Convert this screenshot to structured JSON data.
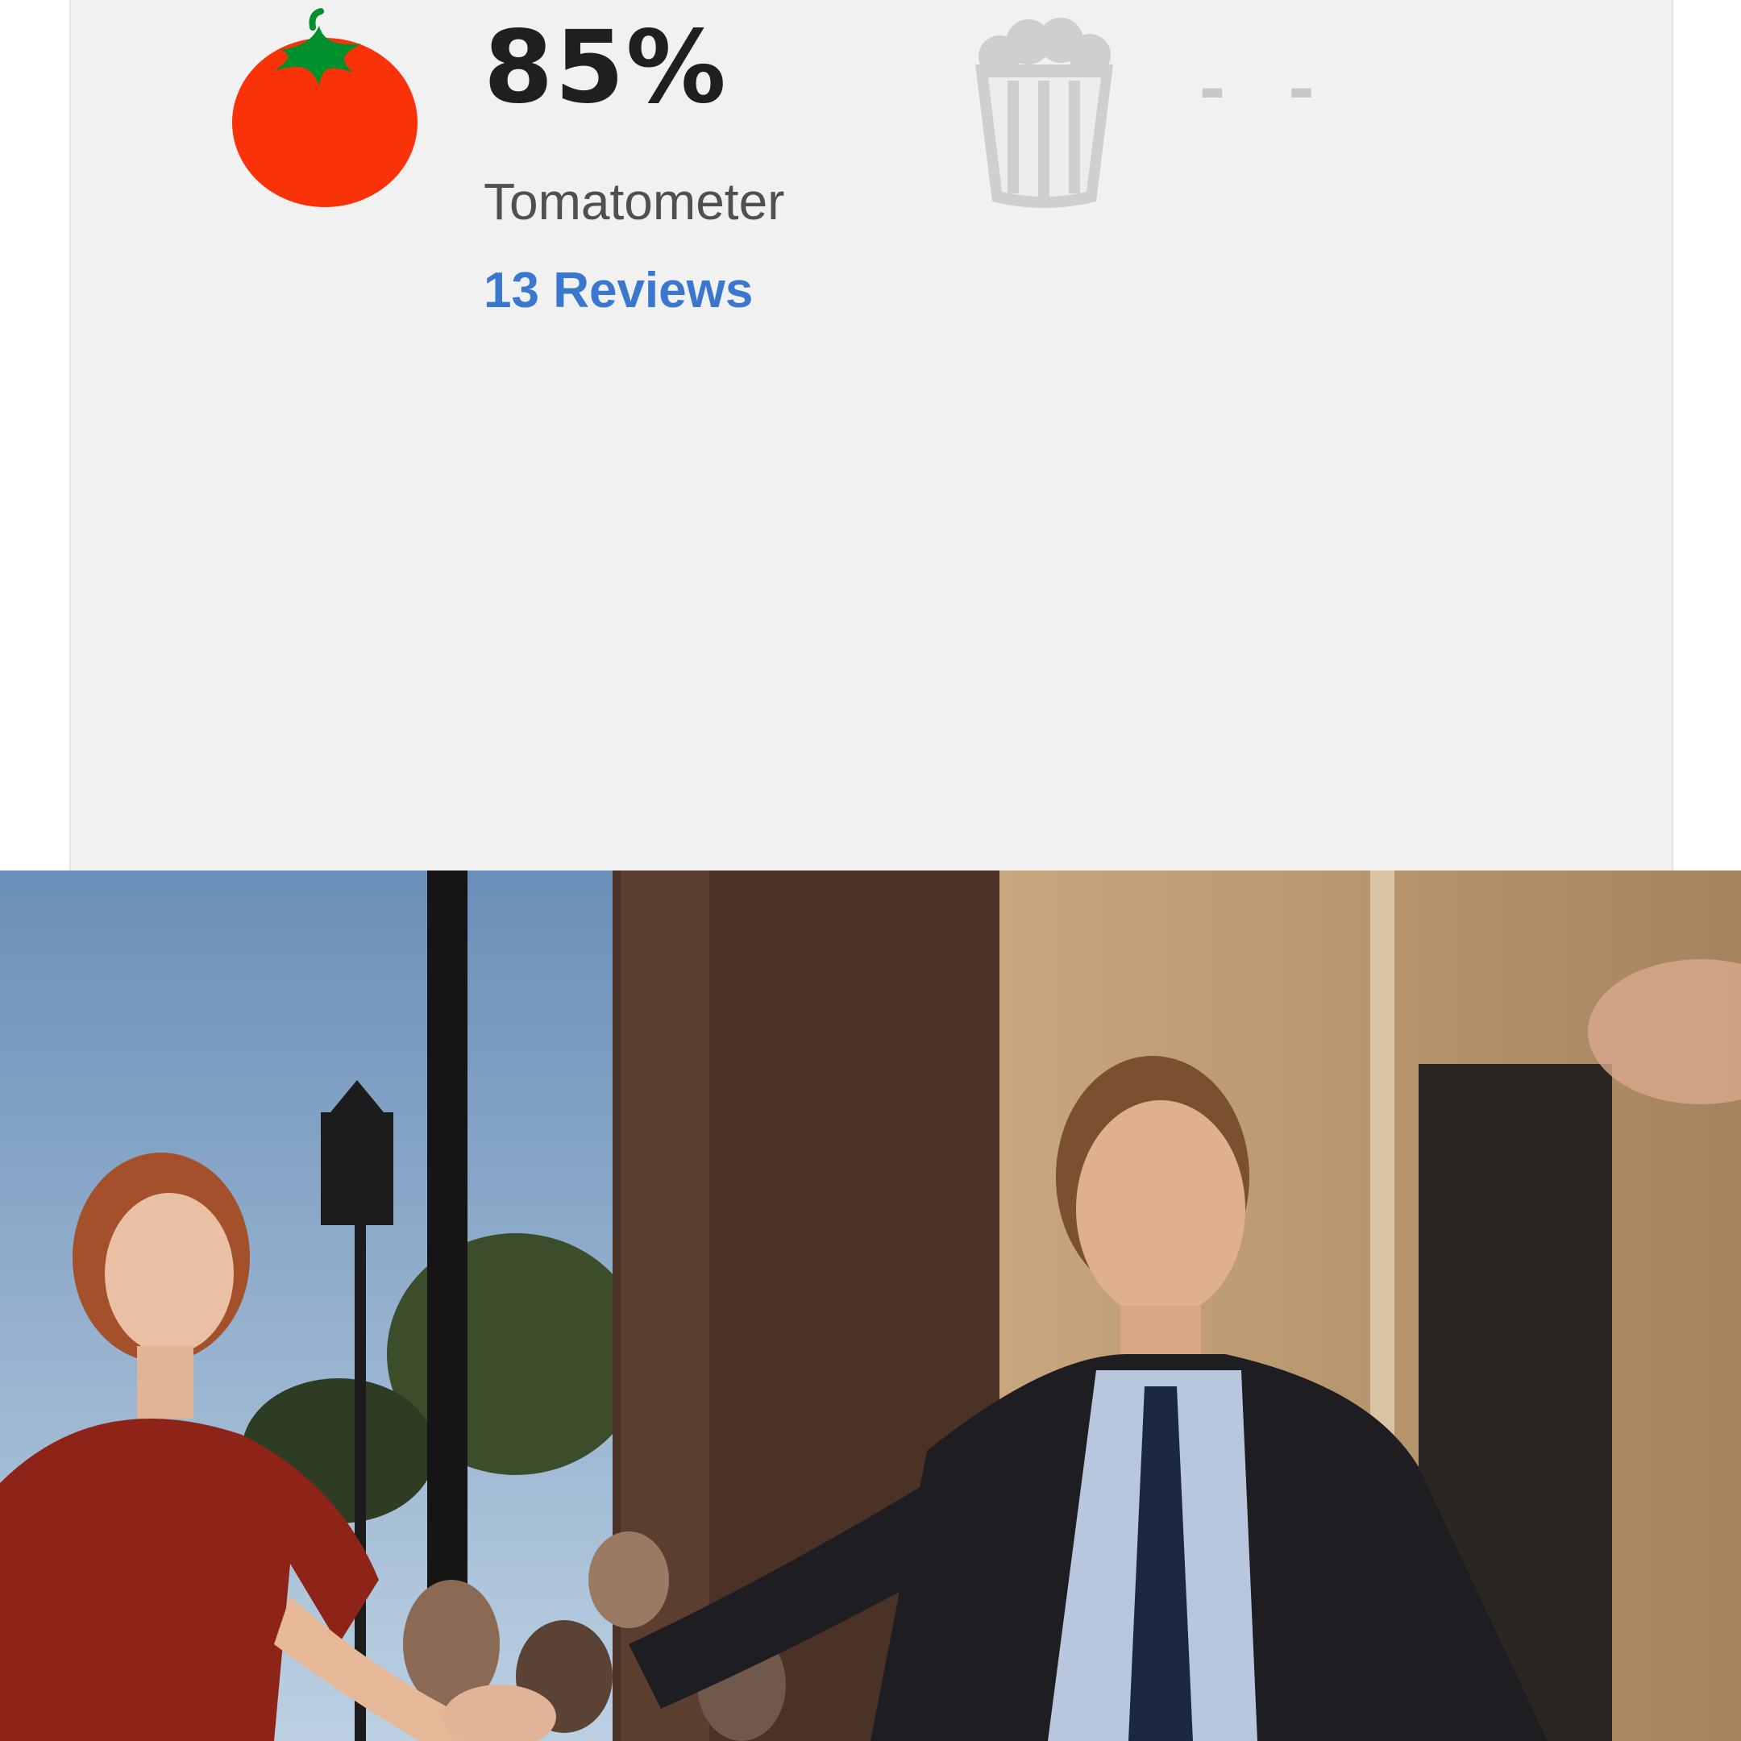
{
  "scores": {
    "tomatometer": {
      "value": "85%",
      "label": "Tomatometer",
      "reviews_link": "13 Reviews",
      "icon": "fresh-tomato-icon"
    },
    "audience": {
      "value": "- -",
      "icon": "popcorn-bucket-icon"
    }
  },
  "colors": {
    "card_background": "#f1f1f1",
    "tomato_red": "#fa320a",
    "leaf_green": "#00912d",
    "link_blue": "#3a78d0",
    "empty_gray": "#c8c8c8"
  }
}
